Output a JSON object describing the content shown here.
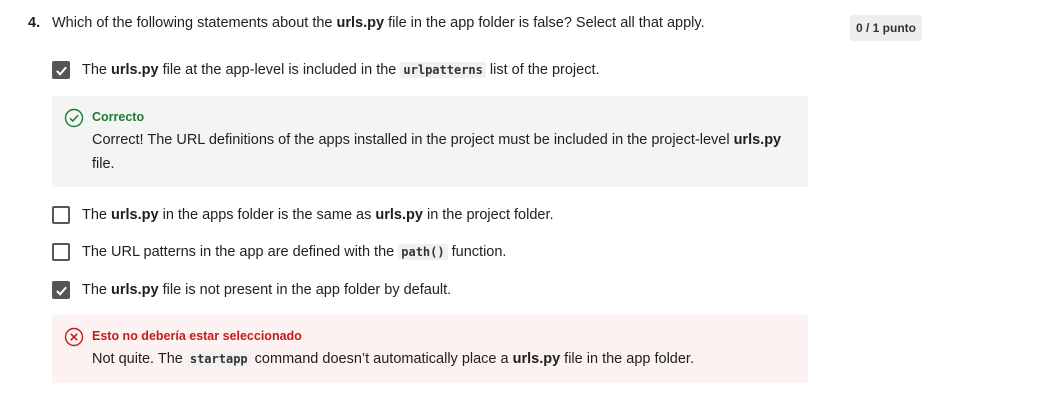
{
  "question": {
    "number": "4.",
    "text_before": "Which of the following statements about the ",
    "text_bold": "urls.py",
    "text_after": " file in the app folder is false? Select all that apply."
  },
  "score": "0 / 1 punto",
  "options": [
    {
      "checked": true,
      "part1": "The ",
      "bold1": "urls.py",
      "part2": " file at the app-level is included in the ",
      "code": "urlpatterns",
      "part3": " list of the project."
    },
    {
      "checked": false,
      "part1": "The ",
      "bold1": "urls.py",
      "part2": " in the apps folder is the same as ",
      "bold2": "urls.py",
      "part3": " in the project folder."
    },
    {
      "checked": false,
      "part1": "The URL patterns in the app are defined with the ",
      "code": "path()",
      "part2": " function."
    },
    {
      "checked": true,
      "part1": "The ",
      "bold1": "urls.py",
      "part2": " file is not present in the app folder by default."
    }
  ],
  "feedback_correct": {
    "title": "Correcto",
    "text": "Correct! The URL definitions of the apps installed in the project must be included in the project-level ",
    "bold": "urls.py",
    "text_after": " file."
  },
  "feedback_wrong": {
    "title": "Esto no debería estar seleccionado",
    "text": "Not quite. The ",
    "code": "startapp",
    "text_mid": " command doesn’t automatically place a ",
    "bold": "urls.py",
    "text_after": " file in the app folder."
  },
  "colors": {
    "correct_accent": "#1f7a38",
    "wrong_accent": "#c21d1d",
    "correct_bg": "#f2f5f2",
    "wrong_bg": "#fdf2f2"
  }
}
